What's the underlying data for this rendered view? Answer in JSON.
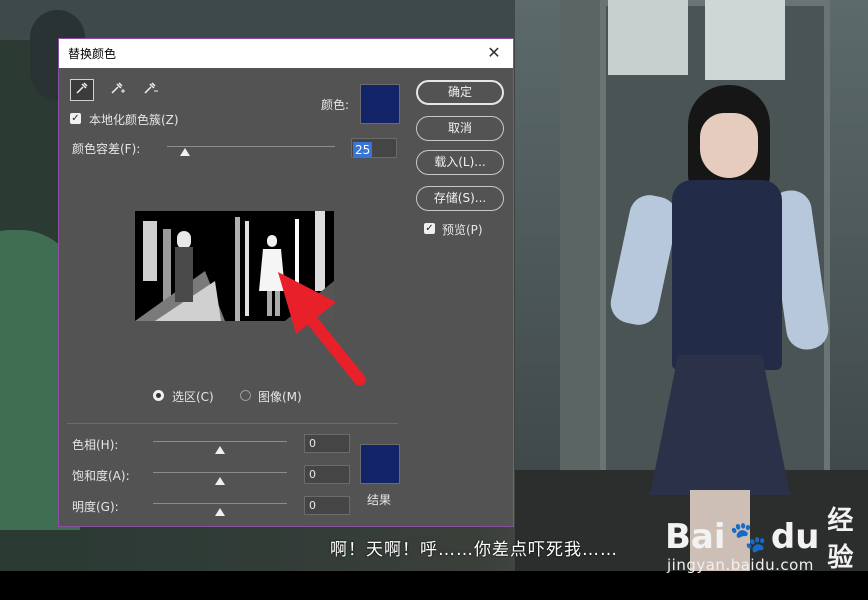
{
  "dialog": {
    "title": "替换颜色",
    "close_icon": "close-icon",
    "tools": [
      "eyedropper-icon",
      "eyedropper-plus-icon",
      "eyedropper-minus-icon"
    ],
    "localized_clusters_label": "本地化颜色簇(Z)",
    "localized_clusters_checked": true,
    "color_label": "颜色:",
    "selected_color": "#142468",
    "fuzziness_label": "颜色容差(F):",
    "fuzziness_value": "25",
    "fuzziness_level": 0.12,
    "selection_radio_label": "选区(C)",
    "image_radio_label": "图像(M)",
    "selected_mode": "selection",
    "hue_label": "色相(H):",
    "hue_value": "0",
    "saturation_label": "饱和度(A):",
    "saturation_value": "0",
    "lightness_label": "明度(G):",
    "lightness_value": "0",
    "result_label": "结果",
    "result_color": "#142468",
    "buttons": {
      "ok": "确定",
      "cancel": "取消",
      "load": "载入(L)...",
      "save": "存储(S)..."
    },
    "preview_label": "预览(P)",
    "preview_checked": true
  },
  "annotation_arrow_color": "#e8202a",
  "subtitle": "啊！天啊！呼……你差点吓死我……",
  "watermark": {
    "brand_bai": "Bai",
    "brand_du": "du",
    "brand_cn": "经验",
    "url": "jingyan.baidu.com"
  }
}
